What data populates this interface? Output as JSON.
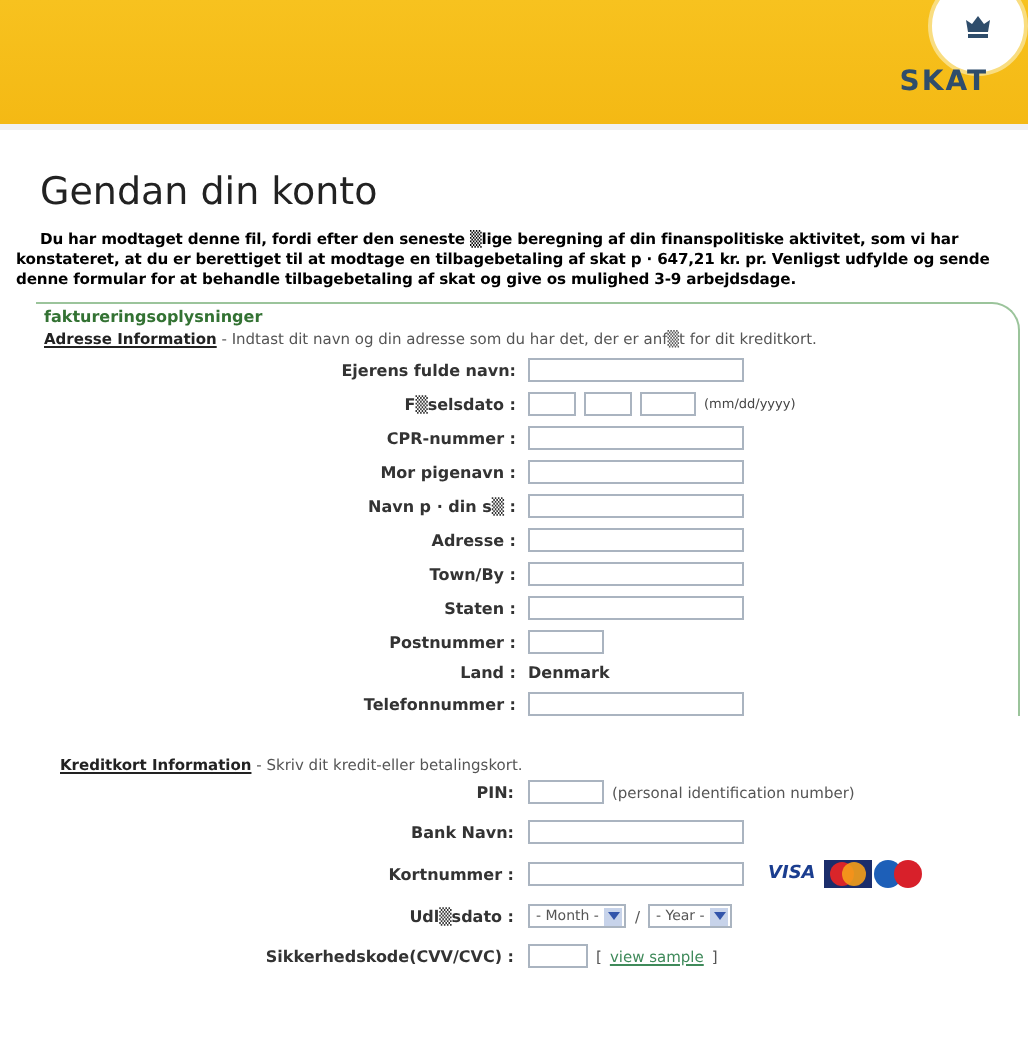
{
  "header": {
    "logo": "SKAT"
  },
  "title": "Gendan din konto",
  "intro": "Du har modtaget denne fil, fordi efter den seneste ▒lige beregning af din finanspolitiske aktivitet, som vi har konstateret, at du er berettiget til at modtage en tilbagebetaling af skat p · 647,21 kr. pr. Venligst udfylde og sende denne formular for at behandle tilbagebetaling af skat og give os mulighed 3-9 arbejdsdage.",
  "billing": {
    "heading": "faktureringsoplysninger",
    "subheading": "Adresse Information",
    "note": " - Indtast dit navn og din adresse som du har det, der er anf▒t for dit kreditkort.",
    "fields": [
      {
        "kind": "text",
        "label": "Ejerens fulde navn:"
      },
      {
        "kind": "date",
        "label": "F▒selsdato :",
        "hint": "(mm/dd/yyyy)"
      },
      {
        "kind": "text",
        "label": "CPR-nummer :"
      },
      {
        "kind": "text",
        "label": "Mor pigenavn :"
      },
      {
        "kind": "text",
        "label": "Navn p · din s▒ :"
      },
      {
        "kind": "text",
        "label": "Adresse :"
      },
      {
        "kind": "text",
        "label": "Town/By :"
      },
      {
        "kind": "text",
        "label": "Staten :"
      },
      {
        "kind": "short",
        "label": "Postnummer :"
      },
      {
        "kind": "static",
        "label": "Land :",
        "value": "Denmark"
      },
      {
        "kind": "text",
        "label": "Telefonnummer :"
      }
    ]
  },
  "card": {
    "subheading": "Kreditkort Information",
    "note": " - Skriv dit kredit-eller betalingskort.",
    "fields": [
      {
        "kind": "short",
        "label": "PIN:",
        "hint": "(personal identification number)"
      },
      {
        "kind": "text",
        "label": "Bank Navn:"
      },
      {
        "kind": "cardnumber",
        "label": "Kortnummer :",
        "logo": "VISA"
      },
      {
        "kind": "expiry",
        "label": "Udl▒sdato :",
        "month": "- Month -",
        "separator": "/",
        "year": "- Year -"
      },
      {
        "kind": "cvv",
        "label": "Sikkerhedskode(CVV/CVC) :",
        "link": "view sample",
        "open": "[",
        "close": "]"
      }
    ]
  }
}
